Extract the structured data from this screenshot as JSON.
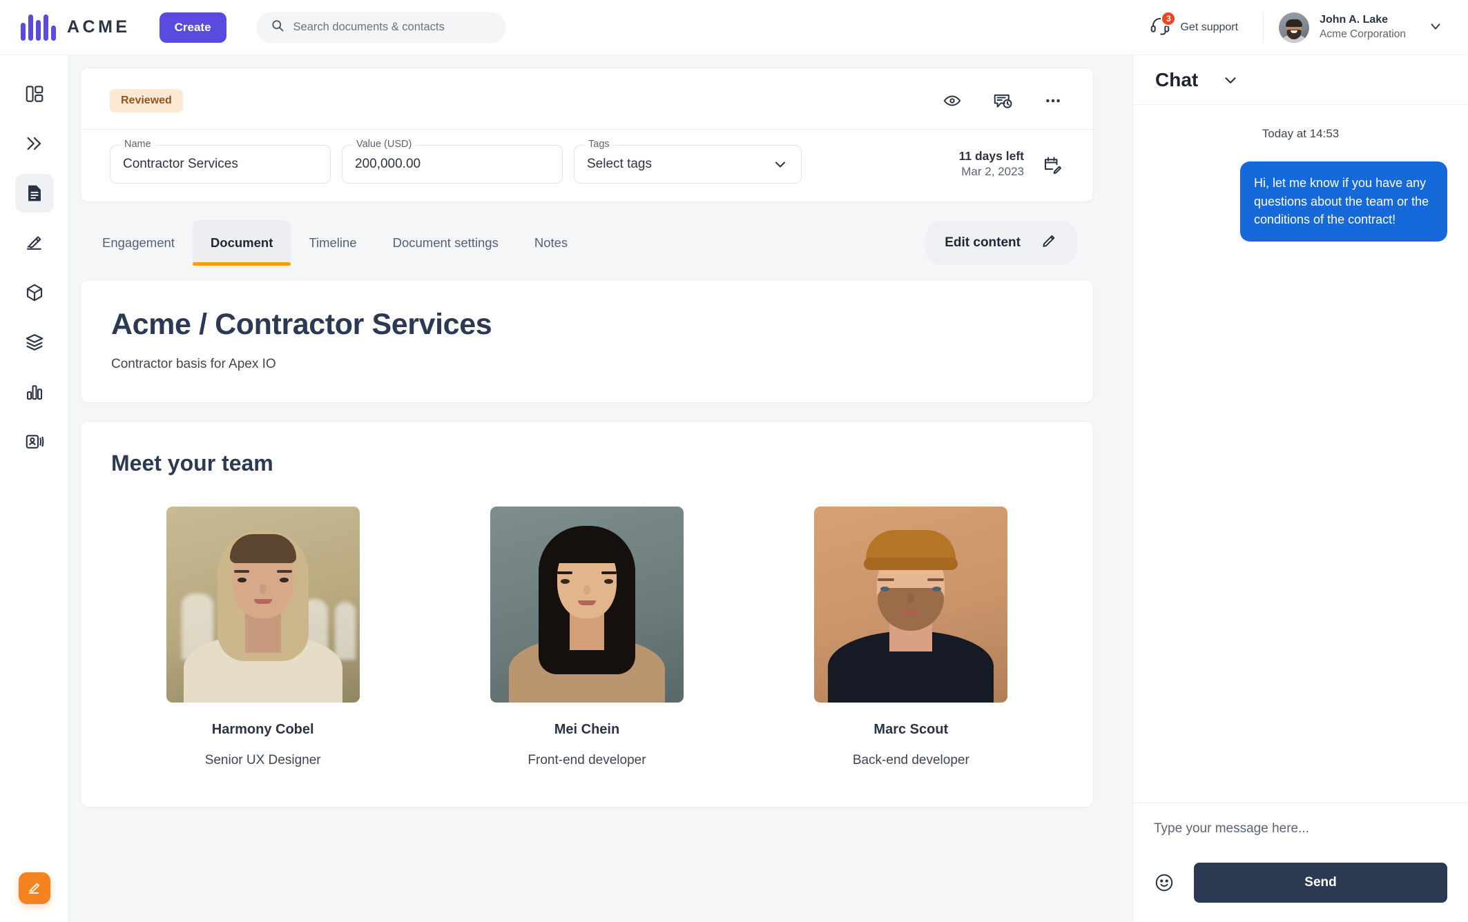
{
  "topbar": {
    "brand_name": "ACME",
    "create_label": "Create",
    "search_placeholder": "Search documents & contacts",
    "search_value": "",
    "support_label": "Get support",
    "support_badge_count": "3",
    "user_name": "John A. Lake",
    "user_org": "Acme Corporation"
  },
  "sidebar": {
    "items": [
      {
        "name": "dashboard-icon",
        "label": "Dashboard"
      },
      {
        "name": "chevrons-right-icon",
        "label": "Workflows"
      },
      {
        "name": "document-icon",
        "label": "Documents"
      },
      {
        "name": "signature-icon",
        "label": "Signatures"
      },
      {
        "name": "cube-icon",
        "label": "Assets"
      },
      {
        "name": "layers-icon",
        "label": "Templates"
      },
      {
        "name": "bar-chart-icon",
        "label": "Reports"
      },
      {
        "name": "contact-card-icon",
        "label": "Contacts"
      }
    ],
    "active_index": 2,
    "fab_label": "New signature"
  },
  "header": {
    "status_badge": "Reviewed",
    "actions": [
      {
        "name": "preview-eye-icon",
        "label": "Preview"
      },
      {
        "name": "comment-history-icon",
        "label": "Activity"
      },
      {
        "name": "more-options-icon",
        "label": "More options"
      }
    ],
    "fields": {
      "name_label": "Name",
      "name_value": "Contractor Services",
      "value_label": "Value (USD)",
      "value_value": "200,000.00",
      "tags_label": "Tags",
      "tags_placeholder": "Select tags"
    },
    "due_main": "11 days left",
    "due_sub": "Mar 2, 2023"
  },
  "tabs": {
    "items": [
      {
        "label": "Engagement"
      },
      {
        "label": "Document"
      },
      {
        "label": "Timeline"
      },
      {
        "label": "Document settings"
      },
      {
        "label": "Notes"
      }
    ],
    "active_index": 1,
    "edit_content_label": "Edit content"
  },
  "document": {
    "title": "Acme / Contractor Services",
    "subtitle": "Contractor basis for Apex IO",
    "team_heading": "Meet your team",
    "team": [
      {
        "name": "Harmony Cobel",
        "role": "Senior UX Designer"
      },
      {
        "name": "Mei Chein",
        "role": "Front-end developer"
      },
      {
        "name": "Marc Scout",
        "role": "Back-end developer"
      }
    ]
  },
  "chat": {
    "title": "Chat",
    "timestamp": "Today at 14:53",
    "message": "Hi, let me know if you have any questions about the team or the conditions of the contract!",
    "input_placeholder": "Type your message here...",
    "input_value": "",
    "send_label": "Send"
  },
  "colors": {
    "brand_purple": "#5b4ae0",
    "accent_orange": "#f59f0b",
    "fab_orange": "#f58220",
    "badge_bg": "#fde9d3",
    "badge_text": "#93541a",
    "chat_bubble": "#1669d8",
    "send_button": "#2b3a52",
    "notification_red": "#ef4423"
  }
}
